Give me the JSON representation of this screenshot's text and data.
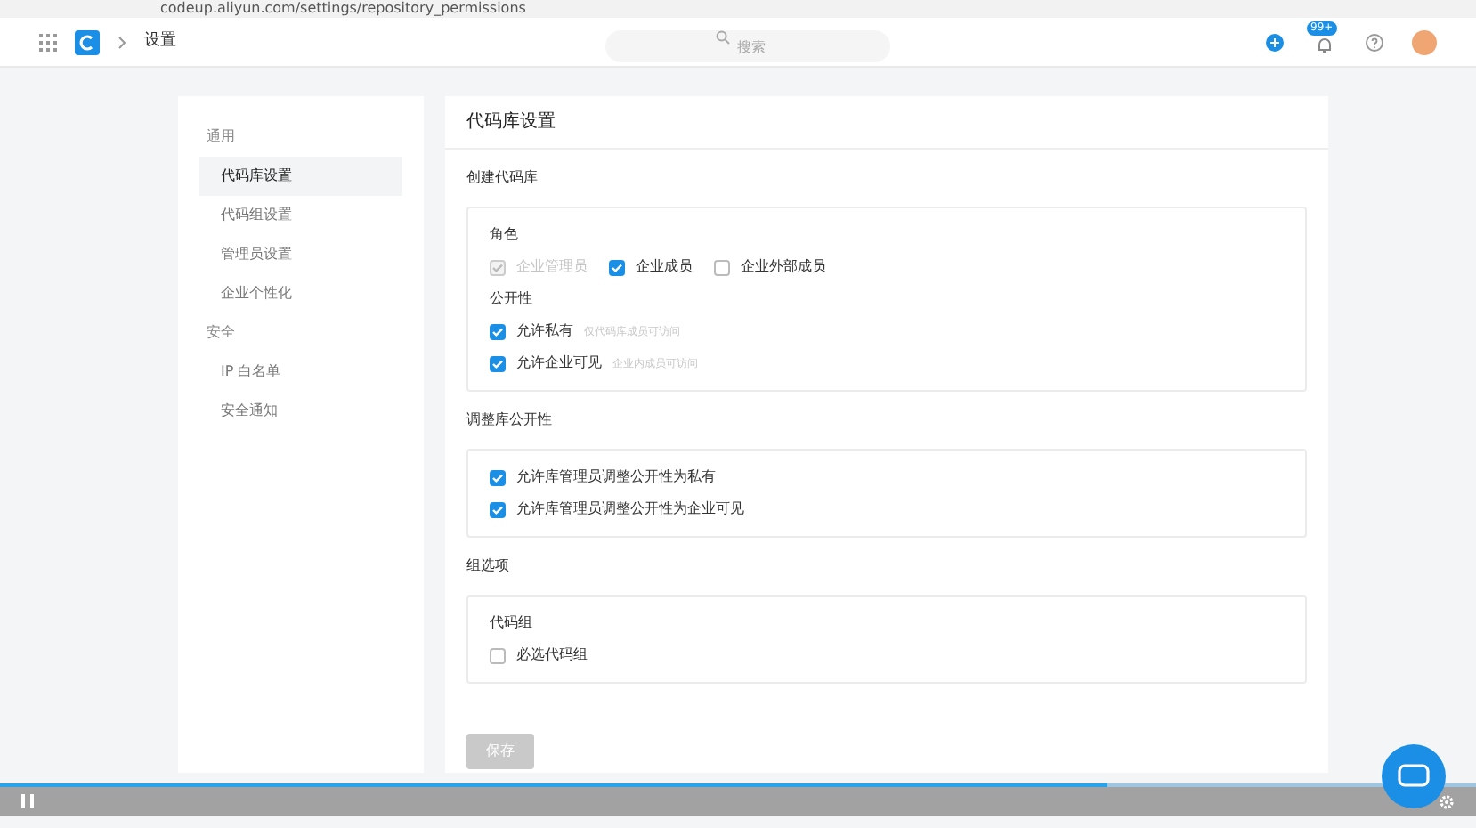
{
  "browser": {
    "url": "codeup.aliyun.com/settings/repository_permissions"
  },
  "header": {
    "breadcrumb": "设置",
    "search": {
      "placeholder": "搜索"
    },
    "badge": "99+"
  },
  "sidebar": {
    "groups": [
      {
        "title": "通用",
        "items": [
          {
            "label": "代码库设置",
            "selected": true
          },
          {
            "label": "代码组设置",
            "selected": false
          },
          {
            "label": "管理员设置",
            "selected": false
          },
          {
            "label": "企业个性化",
            "selected": false
          }
        ]
      },
      {
        "title": "安全",
        "items": [
          {
            "label": "IP 白名单",
            "selected": false
          },
          {
            "label": "安全通知",
            "selected": false
          }
        ]
      }
    ]
  },
  "main": {
    "title": "代码库设置",
    "sections": [
      {
        "title": "创建代码库",
        "blocks": [
          {
            "groups": [
              {
                "title": "角色",
                "kind": "inline",
                "options": [
                  {
                    "label": "企业管理员",
                    "checked": true,
                    "disabled": true
                  },
                  {
                    "label": "企业成员",
                    "checked": true,
                    "disabled": false
                  },
                  {
                    "label": "企业外部成员",
                    "checked": false,
                    "disabled": false
                  }
                ]
              },
              {
                "title": "公开性",
                "kind": "stack",
                "options": [
                  {
                    "label": "允许私有",
                    "hint": "仅代码库成员可访问",
                    "checked": true,
                    "disabled": false
                  },
                  {
                    "label": "允许企业可见",
                    "hint": "企业内成员可访问",
                    "checked": true,
                    "disabled": false
                  }
                ]
              }
            ]
          }
        ]
      },
      {
        "title": "调整库公开性",
        "blocks": [
          {
            "groups": [
              {
                "kind": "stack",
                "options": [
                  {
                    "label": "允许库管理员调整公开性为私有",
                    "checked": true,
                    "disabled": false
                  },
                  {
                    "label": "允许库管理员调整公开性为企业可见",
                    "checked": true,
                    "disabled": false
                  }
                ]
              }
            ]
          }
        ]
      },
      {
        "title": "组选项",
        "blocks": [
          {
            "groups": [
              {
                "title": "代码组",
                "kind": "stack",
                "options": [
                  {
                    "label": "必选代码组",
                    "checked": false,
                    "disabled": false
                  }
                ]
              }
            ]
          }
        ]
      }
    ],
    "save_button": {
      "label": "保存",
      "disabled": true
    }
  },
  "video": {
    "playing": true,
    "progress": {
      "level": 0.75
    }
  }
}
